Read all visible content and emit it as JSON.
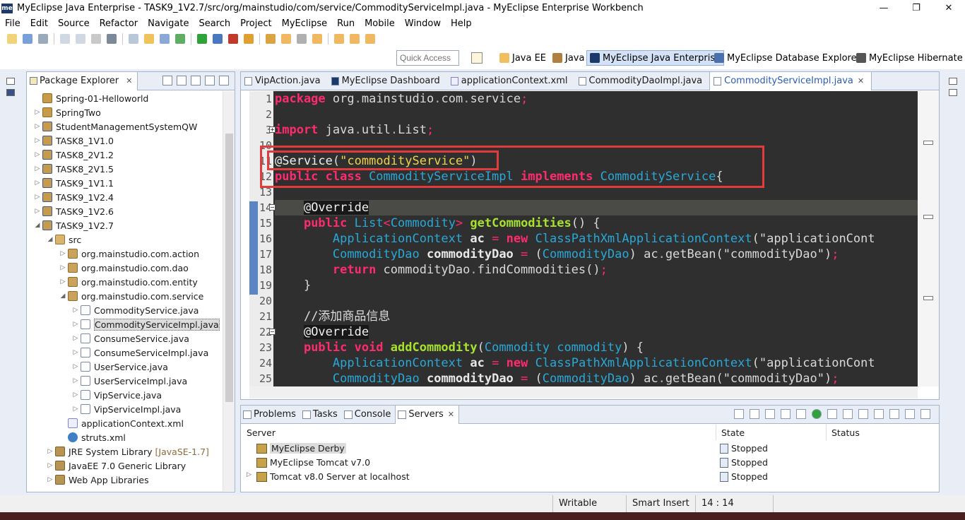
{
  "window": {
    "title": "MyEclipse Java Enterprise - TASK9_1V2.7/src/org/mainstudio/com/service/CommodityServiceImpl.java - MyEclipse Enterprise Workbench",
    "logo": "me",
    "minimize": "—",
    "maximize": "❐",
    "close": "✕"
  },
  "menu": [
    "File",
    "Edit",
    "Source",
    "Refactor",
    "Navigate",
    "Search",
    "Project",
    "MyEclipse",
    "Run",
    "Mobile",
    "Window",
    "Help"
  ],
  "quick_access": {
    "placeholder": "Quick Access"
  },
  "perspectives": [
    {
      "label": "Java EE",
      "active": false
    },
    {
      "label": "Java",
      "active": false
    },
    {
      "label": "MyEclipse Java Enterprise",
      "active": true
    },
    {
      "label": "MyEclipse Database Explorer",
      "active": false
    },
    {
      "label": "MyEclipse Hibernate",
      "active": false
    }
  ],
  "package_explorer": {
    "title": "Package Explorer",
    "items": [
      {
        "label": "Spring-01-Helloworld",
        "depth": 0,
        "twisty": "",
        "icon": "proj"
      },
      {
        "label": "SpringTwo",
        "depth": 0,
        "twisty": ">",
        "icon": "proj"
      },
      {
        "label": "StudentManagementSystemQW",
        "depth": 0,
        "twisty": ">",
        "icon": "projx"
      },
      {
        "label": "TASK8_1V1.0",
        "depth": 0,
        "twisty": ">",
        "icon": "projx"
      },
      {
        "label": "TASK8_2V1.2",
        "depth": 0,
        "twisty": ">",
        "icon": "projx"
      },
      {
        "label": "TASK8_2V1.5",
        "depth": 0,
        "twisty": ">",
        "icon": "projx"
      },
      {
        "label": "TASK9_1V1.1",
        "depth": 0,
        "twisty": ">",
        "icon": "projx"
      },
      {
        "label": "TASK9_1V2.4",
        "depth": 0,
        "twisty": ">",
        "icon": "projx"
      },
      {
        "label": "TASK9_1V2.6",
        "depth": 0,
        "twisty": ">",
        "icon": "projx"
      },
      {
        "label": "TASK9_1V2.7",
        "depth": 0,
        "twisty": "v",
        "icon": "projx"
      },
      {
        "label": "src",
        "depth": 1,
        "twisty": "v",
        "icon": "srcf"
      },
      {
        "label": "org.mainstudio.com.action",
        "depth": 2,
        "twisty": ">",
        "icon": "pk"
      },
      {
        "label": "org.mainstudio.com.dao",
        "depth": 2,
        "twisty": ">",
        "icon": "pk"
      },
      {
        "label": "org.mainstudio.com.entity",
        "depth": 2,
        "twisty": ">",
        "icon": "pk"
      },
      {
        "label": "org.mainstudio.com.service",
        "depth": 2,
        "twisty": "v",
        "icon": "pk"
      },
      {
        "label": "CommodityService.java",
        "depth": 3,
        "twisty": ">",
        "icon": "jf"
      },
      {
        "label": "CommodityServiceImpl.java",
        "depth": 3,
        "twisty": ">",
        "icon": "jf",
        "selected": true
      },
      {
        "label": "ConsumeService.java",
        "depth": 3,
        "twisty": ">",
        "icon": "jf"
      },
      {
        "label": "ConsumeServiceImpl.java",
        "depth": 3,
        "twisty": ">",
        "icon": "jf"
      },
      {
        "label": "UserService.java",
        "depth": 3,
        "twisty": ">",
        "icon": "jf"
      },
      {
        "label": "UserServiceImpl.java",
        "depth": 3,
        "twisty": ">",
        "icon": "jf"
      },
      {
        "label": "VipService.java",
        "depth": 3,
        "twisty": ">",
        "icon": "jf"
      },
      {
        "label": "VipServiceImpl.java",
        "depth": 3,
        "twisty": ">",
        "icon": "jf"
      },
      {
        "label": "applicationContext.xml",
        "depth": 2,
        "twisty": "",
        "icon": "xml"
      },
      {
        "label": "struts.xml",
        "depth": 2,
        "twisty": "",
        "icon": "gear"
      },
      {
        "label": "JRE System Library",
        "decoration": "[JavaSE-1.7]",
        "depth": 1,
        "twisty": ">",
        "icon": "lib"
      },
      {
        "label": "JavaEE 7.0 Generic Library",
        "depth": 1,
        "twisty": ">",
        "icon": "lib"
      },
      {
        "label": "Web App Libraries",
        "depth": 1,
        "twisty": ">",
        "icon": "lib"
      }
    ]
  },
  "editor": {
    "tabs": [
      {
        "label": "VipAction.java",
        "icon": "jf",
        "active": false
      },
      {
        "label": "MyEclipse Dashboard",
        "icon": "dash",
        "active": false
      },
      {
        "label": "applicationContext.xml",
        "icon": "x",
        "active": false
      },
      {
        "label": "CommodityDaoImpl.java",
        "icon": "jf",
        "active": false
      },
      {
        "label": "CommodityServiceImpl.java",
        "icon": "jf",
        "active": true
      }
    ],
    "lines": [
      {
        "n": "1",
        "fold": "",
        "toks": [
          [
            "kw",
            "package"
          ],
          [
            "pl",
            " org"
          ],
          [
            "dt",
            "."
          ],
          [
            "pl",
            "mainstudio"
          ],
          [
            "dt",
            "."
          ],
          [
            "pl",
            "com"
          ],
          [
            "dt",
            "."
          ],
          [
            "pl",
            "service"
          ],
          [
            "op",
            ";"
          ]
        ]
      },
      {
        "n": "2",
        "fold": "",
        "toks": []
      },
      {
        "n": "3",
        "fold": "+",
        "toks": [
          [
            "kw",
            "import"
          ],
          [
            "pl",
            " java"
          ],
          [
            "dt",
            "."
          ],
          [
            "pl",
            "util"
          ],
          [
            "dt",
            "."
          ],
          [
            "pl",
            "List"
          ],
          [
            "op",
            ";"
          ]
        ]
      },
      {
        "n": "10",
        "fold": "",
        "toks": []
      },
      {
        "n": "11",
        "fold": "",
        "toks": [
          [
            "ann2",
            "@Service"
          ],
          [
            "pl",
            "("
          ],
          [
            "str",
            "\"commodityService\""
          ],
          [
            "pl",
            ")"
          ]
        ]
      },
      {
        "n": "12",
        "fold": "",
        "toks": [
          [
            "kw",
            "public class "
          ],
          [
            "ty",
            "CommodityServiceImpl"
          ],
          [
            "pl",
            " "
          ],
          [
            "kw",
            "implements"
          ],
          [
            "pl",
            " "
          ],
          [
            "ty",
            "CommodityService"
          ],
          [
            "pl",
            "{"
          ]
        ]
      },
      {
        "n": "13",
        "fold": "",
        "toks": []
      },
      {
        "n": "14",
        "fold": "-",
        "hl": true,
        "toks": [
          [
            "pl",
            "    "
          ],
          [
            "ann",
            "@Override"
          ]
        ]
      },
      {
        "n": "15",
        "fold": "",
        "toks": [
          [
            "pl",
            "    "
          ],
          [
            "kw",
            "public "
          ],
          [
            "ty",
            "List"
          ],
          [
            "op",
            "<"
          ],
          [
            "ty",
            "Commodity"
          ],
          [
            "op",
            "> "
          ],
          [
            "fn",
            "getCommodities"
          ],
          [
            "pl",
            "() {"
          ]
        ]
      },
      {
        "n": "16",
        "fold": "",
        "toks": [
          [
            "pl",
            "        "
          ],
          [
            "ty",
            "ApplicationContext"
          ],
          [
            "pl",
            " "
          ],
          [
            "vr",
            "ac"
          ],
          [
            "pl",
            " "
          ],
          [
            "op",
            "="
          ],
          [
            "pl",
            " "
          ],
          [
            "kw",
            "new"
          ],
          [
            "pl",
            " "
          ],
          [
            "ty",
            "ClassPathXmlApplicationContext"
          ],
          [
            "pl",
            "(\"applicationCont"
          ]
        ]
      },
      {
        "n": "17",
        "fold": "",
        "toks": [
          [
            "pl",
            "        "
          ],
          [
            "ty",
            "CommodityDao"
          ],
          [
            "pl",
            " "
          ],
          [
            "vr",
            "commodityDao"
          ],
          [
            "pl",
            " "
          ],
          [
            "op",
            "="
          ],
          [
            "pl",
            " ("
          ],
          [
            "ty",
            "CommodityDao"
          ],
          [
            "pl",
            ") ac"
          ],
          [
            "dt",
            "."
          ],
          [
            "pl",
            "getBean(\"commodityDao\")"
          ],
          [
            "op",
            ";"
          ]
        ]
      },
      {
        "n": "18",
        "fold": "",
        "toks": [
          [
            "pl",
            "        "
          ],
          [
            "kw",
            "return"
          ],
          [
            "pl",
            " commodityDao"
          ],
          [
            "dt",
            "."
          ],
          [
            "pl",
            "findCommodities()"
          ],
          [
            "op",
            ";"
          ]
        ]
      },
      {
        "n": "19",
        "fold": "",
        "toks": [
          [
            "pl",
            "    }"
          ]
        ]
      },
      {
        "n": "20",
        "fold": "",
        "toks": []
      },
      {
        "n": "21",
        "fold": "",
        "toks": [
          [
            "pl",
            "    "
          ],
          [
            "cm",
            "//添加商品信息"
          ]
        ]
      },
      {
        "n": "22",
        "fold": "-",
        "toks": [
          [
            "pl",
            "    "
          ],
          [
            "ann",
            "@Override"
          ]
        ]
      },
      {
        "n": "23",
        "fold": "",
        "toks": [
          [
            "pl",
            "    "
          ],
          [
            "kw",
            "public void "
          ],
          [
            "fn",
            "addCommodity"
          ],
          [
            "pl",
            "("
          ],
          [
            "ty",
            "Commodity commodity"
          ],
          [
            "pl",
            ") {"
          ]
        ]
      },
      {
        "n": "24",
        "fold": "",
        "toks": [
          [
            "pl",
            "        "
          ],
          [
            "ty",
            "ApplicationContext"
          ],
          [
            "pl",
            " "
          ],
          [
            "vr",
            "ac"
          ],
          [
            "pl",
            " "
          ],
          [
            "op",
            "="
          ],
          [
            "pl",
            " "
          ],
          [
            "kw",
            "new"
          ],
          [
            "pl",
            " "
          ],
          [
            "ty",
            "ClassPathXmlApplicationContext"
          ],
          [
            "pl",
            "(\"applicationCont"
          ]
        ]
      },
      {
        "n": "25",
        "fold": "",
        "toks": [
          [
            "pl",
            "        "
          ],
          [
            "ty",
            "CommodityDao"
          ],
          [
            "pl",
            " "
          ],
          [
            "vr",
            "commodityDao"
          ],
          [
            "pl",
            " "
          ],
          [
            "op",
            "="
          ],
          [
            "pl",
            " ("
          ],
          [
            "ty",
            "CommodityDao"
          ],
          [
            "pl",
            ") ac"
          ],
          [
            "dt",
            "."
          ],
          [
            "pl",
            "getBean(\"commodityDao\")"
          ],
          [
            "op",
            ";"
          ]
        ]
      }
    ]
  },
  "bottom_panel": {
    "tabs": [
      {
        "label": "Problems",
        "active": false
      },
      {
        "label": "Tasks",
        "active": false
      },
      {
        "label": "Console",
        "active": false
      },
      {
        "label": "Servers",
        "active": true
      }
    ],
    "columns": [
      "Server",
      "State",
      "Status"
    ],
    "rows": [
      {
        "server": "MyEclipse Derby",
        "state": "Stopped",
        "status": "",
        "selected": true,
        "twisty": ""
      },
      {
        "server": "MyEclipse Tomcat v7.0",
        "state": "Stopped",
        "status": "",
        "twisty": ""
      },
      {
        "server": "Tomcat v8.0 Server at localhost",
        "state": "Stopped",
        "status": "",
        "twisty": ">"
      }
    ]
  },
  "status_bar": {
    "writable": "Writable",
    "insert_mode": "Smart Insert",
    "position": "14 : 14"
  },
  "colors": {
    "editor_bg": "#2f2f2f",
    "keyword": "#ff2b6f",
    "type": "#29a8d8",
    "string": "#f0d24a",
    "method": "#a6e22e",
    "highlight_box": "#e23b3b",
    "active_tab_text": "#2a5db0"
  }
}
